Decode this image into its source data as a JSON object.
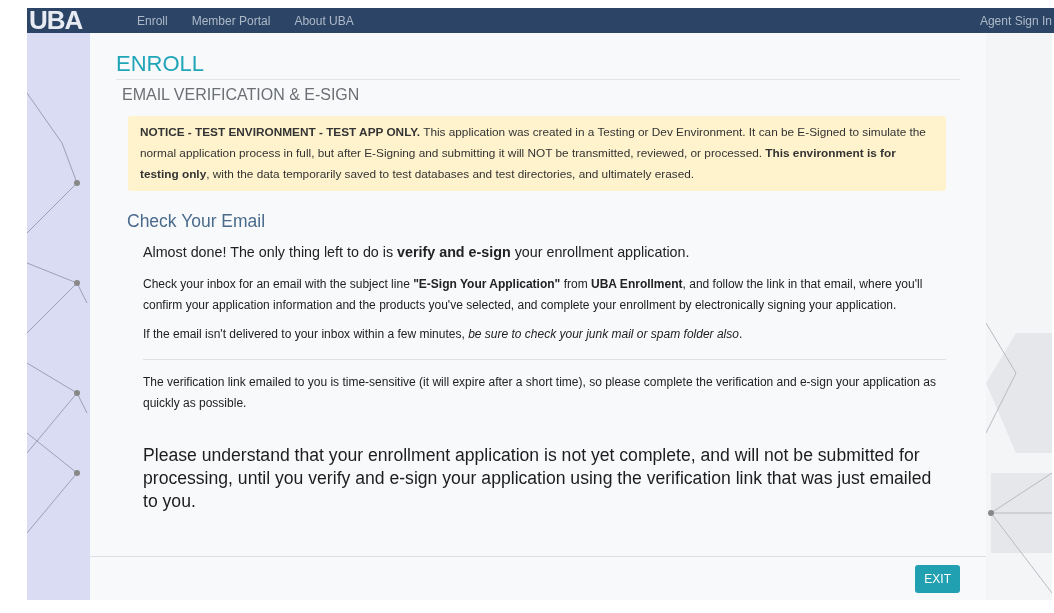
{
  "navbar": {
    "logo": "UBA",
    "links": [
      {
        "label": "Enroll"
      },
      {
        "label": "Member Portal"
      },
      {
        "label": "About UBA"
      }
    ],
    "right_link": "Agent Sign In"
  },
  "page": {
    "title": "ENROLL",
    "subtitle": "EMAIL VERIFICATION & E-SIGN",
    "notice": "**NOTICE - TEST ENVIRONMENT - TEST APP ONLY.** This application was created in a Testing or Dev Environment. It can be E-Signed to simulate the normal application process in full, but after E-Signing and submitting it will NOT be transmitted, reviewed, or processed. **This environment is for testing only**, with the data temporarily saved to test databases and test directories, and ultimately erased.",
    "section_title": "Check Your Email",
    "lead": "Almost done! The only thing left to do is **verify and e-sign** your enrollment application.",
    "paragraphs": [
      "Check your inbox for an email with the subject line **\"E-Sign Your Application\"** from **UBA Enrollment**, and follow the link in that email, where you'll confirm your application information and the products you've selected, and complete your enrollment by electronically signing your application.",
      "If the email isn't delivered to your inbox within a few minutes, *be sure to check your junk mail or spam folder also*."
    ],
    "note": "The verification link emailed to you is time-sensitive (it will expire after a short time), so please complete the verification and e-sign your application as quickly as possible.",
    "warning": "Please understand that your enrollment application is not yet complete, and will not be submitted for processing, until you verify and e-sign your application using the verification link that was just emailed to you.",
    "exit_button": "EXIT"
  }
}
